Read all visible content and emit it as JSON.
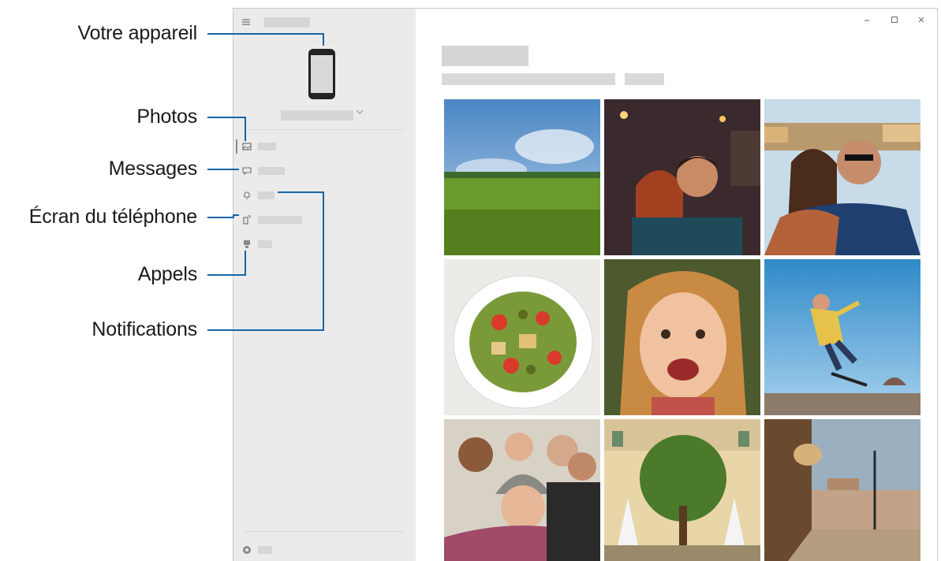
{
  "callouts": {
    "device": "Votre appareil",
    "photos": "Photos",
    "messages": "Messages",
    "screen": "Écran du téléphone",
    "calls": "Appels",
    "notifications": "Notifications"
  },
  "window": {
    "controls": [
      "minimize-icon",
      "maximize-icon",
      "close-icon"
    ]
  },
  "sidebar": {
    "items": [
      {
        "icon": "photos-icon",
        "active": true
      },
      {
        "icon": "messages-icon"
      },
      {
        "icon": "notifications-icon"
      },
      {
        "icon": "phone-screen-icon"
      },
      {
        "icon": "calls-icon"
      }
    ],
    "bottom": {
      "icon": "settings-icon"
    }
  },
  "gallery": {
    "photos": [
      {
        "subject": "green-field-landscape"
      },
      {
        "subject": "couple-selfie-night"
      },
      {
        "subject": "couple-selfie-seaside"
      },
      {
        "subject": "salad-bowl"
      },
      {
        "subject": "laughing-child"
      },
      {
        "subject": "skateboarder-jump"
      },
      {
        "subject": "group-selfie"
      },
      {
        "subject": "tree-courtyard"
      },
      {
        "subject": "old-town-street"
      }
    ]
  },
  "colors": {
    "callout_line": "#1565a8",
    "sidebar_bg": "#ebebeb",
    "placeholder": "#d6d6d6"
  }
}
